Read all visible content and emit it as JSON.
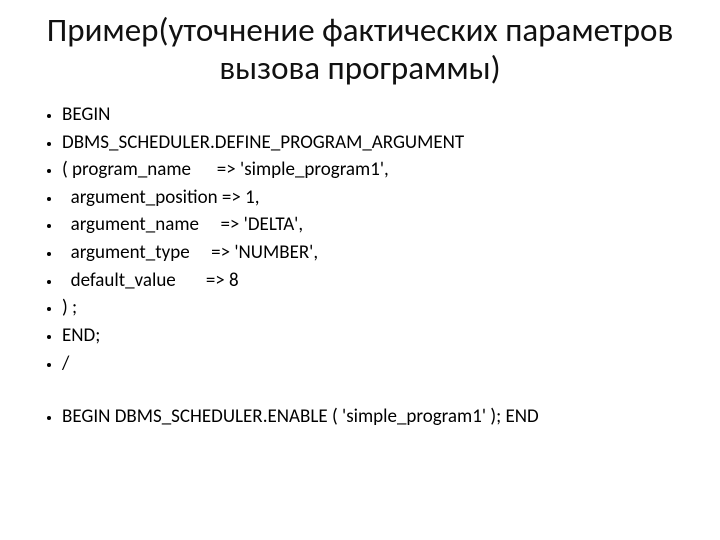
{
  "title": "Пример(уточнение фактических параметров вызова программы)",
  "lines": [
    "BEGIN",
    "DBMS_SCHEDULER.DEFINE_PROGRAM_ARGUMENT",
    "( program_name      => 'simple_program1',",
    "  argument_position => 1,",
    "  argument_name     => 'DELTA',",
    "  argument_type     => 'NUMBER',",
    "  default_value       => 8",
    ") ;",
    "END;",
    "/",
    "",
    "BEGIN DBMS_SCHEDULER.ENABLE ( 'simple_program1' ); END"
  ]
}
